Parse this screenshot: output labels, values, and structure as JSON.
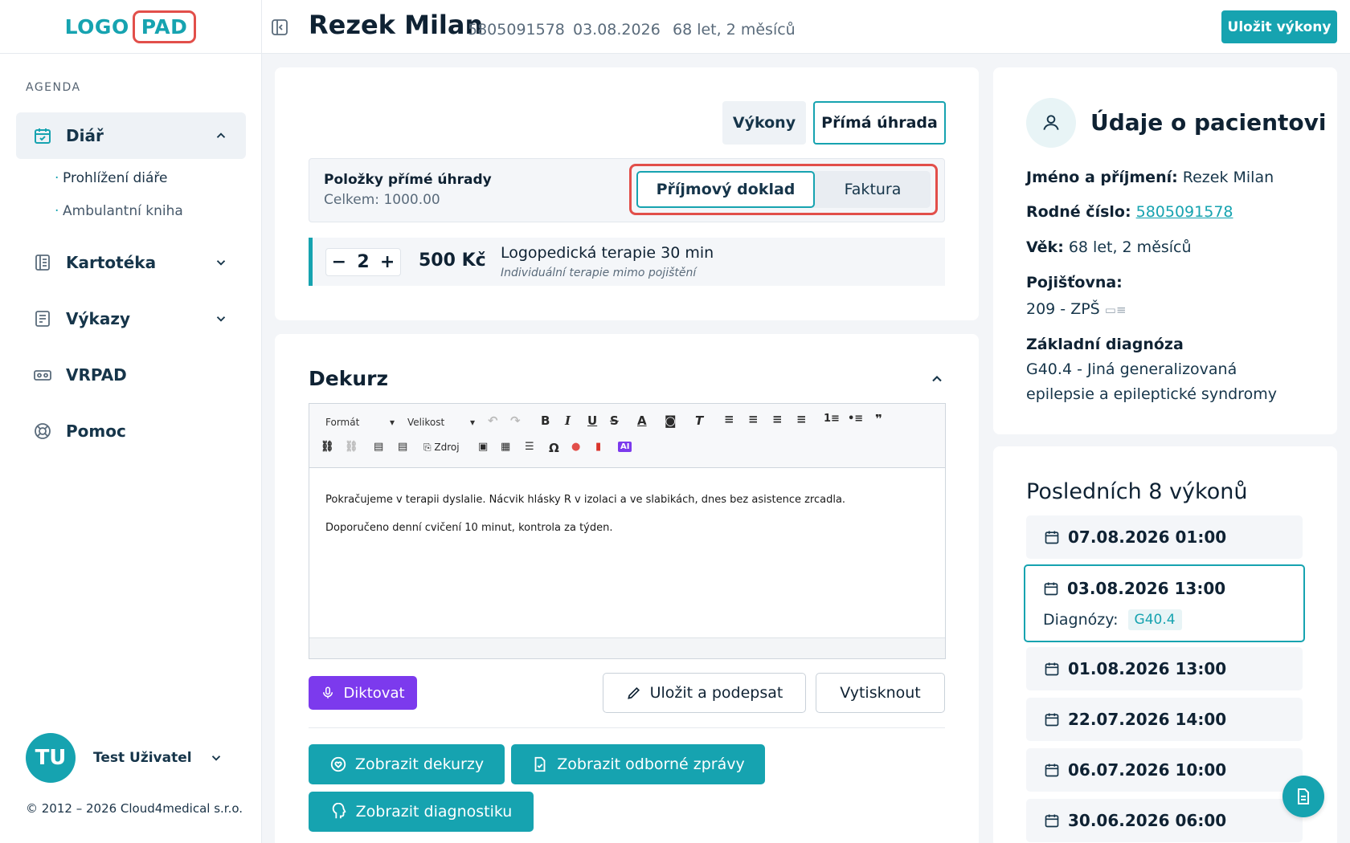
{
  "logo": {
    "left": "LOGO",
    "right": "PAD"
  },
  "sidebar": {
    "section_label": "AGENDA",
    "items": [
      {
        "label": "Diář",
        "icon": "calendar-icon"
      },
      {
        "label": "Kartotéka",
        "icon": "book-icon"
      },
      {
        "label": "Výkazy",
        "icon": "report-icon"
      },
      {
        "label": "VRPAD",
        "icon": "vr-icon"
      },
      {
        "label": "Pomoc",
        "icon": "lifebuoy-icon"
      }
    ],
    "sub_items": [
      "Prohlížení diáře",
      "Ambulantní kniha"
    ],
    "user": {
      "initials": "TU",
      "name": "Test Uživatel"
    },
    "copyright": "© 2012 – 2026 Cloud4medical s.r.o."
  },
  "header": {
    "patient_name": "Rezek Milan",
    "birth_number": "5805091578",
    "date": "03.08.2026",
    "age": "68 let, 2 měsíců",
    "save_label": "Uložit výkony"
  },
  "payment": {
    "tabs": [
      "Výkony",
      "Přímá úhrada"
    ],
    "items_title": "Položky přímé úhrady",
    "items_total": "Celkem: 1000.00",
    "doc_types": [
      "Příjmový doklad",
      "Faktura"
    ],
    "line": {
      "qty": "2",
      "price": "500 Kč",
      "name": "Logopedická terapie 30 min",
      "sub": "Individuální terapie mimo pojištění"
    }
  },
  "dekurz": {
    "title": "Dekurz",
    "toolbar": {
      "format": "Formát",
      "size": "Velikost",
      "source": "Zdroj"
    },
    "paragraphs": [
      "Pokračujeme v terapii dyslalie. Nácvik hlásky R v izolaci a ve slabikách, dnes bez asistence zrcadla.",
      "Doporučeno denní cvičení 10 minut, kontrola za týden."
    ],
    "dictate_label": "Diktovat",
    "save_sign_label": "Uložit a podepsat",
    "print_label": "Vytisknout",
    "show_dekurzy": "Zobrazit dekurzy",
    "show_reports": "Zobrazit odborné zprávy",
    "show_diag": "Zobrazit diagnostiku"
  },
  "patient_info": {
    "title": "Údaje o pacientovi",
    "name_label": "Jméno a příjmení:",
    "name_value": "Rezek Milan",
    "rc_label": "Rodné číslo:",
    "rc_value": "5805091578",
    "age_label": "Věk:",
    "age_value": "68 let, 2 měsíců",
    "ins_label": "Pojišťovna:",
    "ins_value": "209 - ZPŠ",
    "diag_label": "Základní diagnóza",
    "diag_value_1": "G40.4 - Jiná generalizovaná",
    "diag_value_2": "epilepsie a epileptické syndromy"
  },
  "last_visits": {
    "title": "Posledních 8 výkonů",
    "diag_label": "Diagnózy:",
    "diag_tag": "G40.4",
    "items": [
      "07.08.2026 01:00",
      "03.08.2026 13:00",
      "01.08.2026 13:00",
      "22.07.2026 14:00",
      "06.07.2026 10:00",
      "30.06.2026 06:00"
    ]
  },
  "colors": {
    "accent": "#16a3b0",
    "highlight": "#e24f4a",
    "dictate": "#7c3aed"
  }
}
